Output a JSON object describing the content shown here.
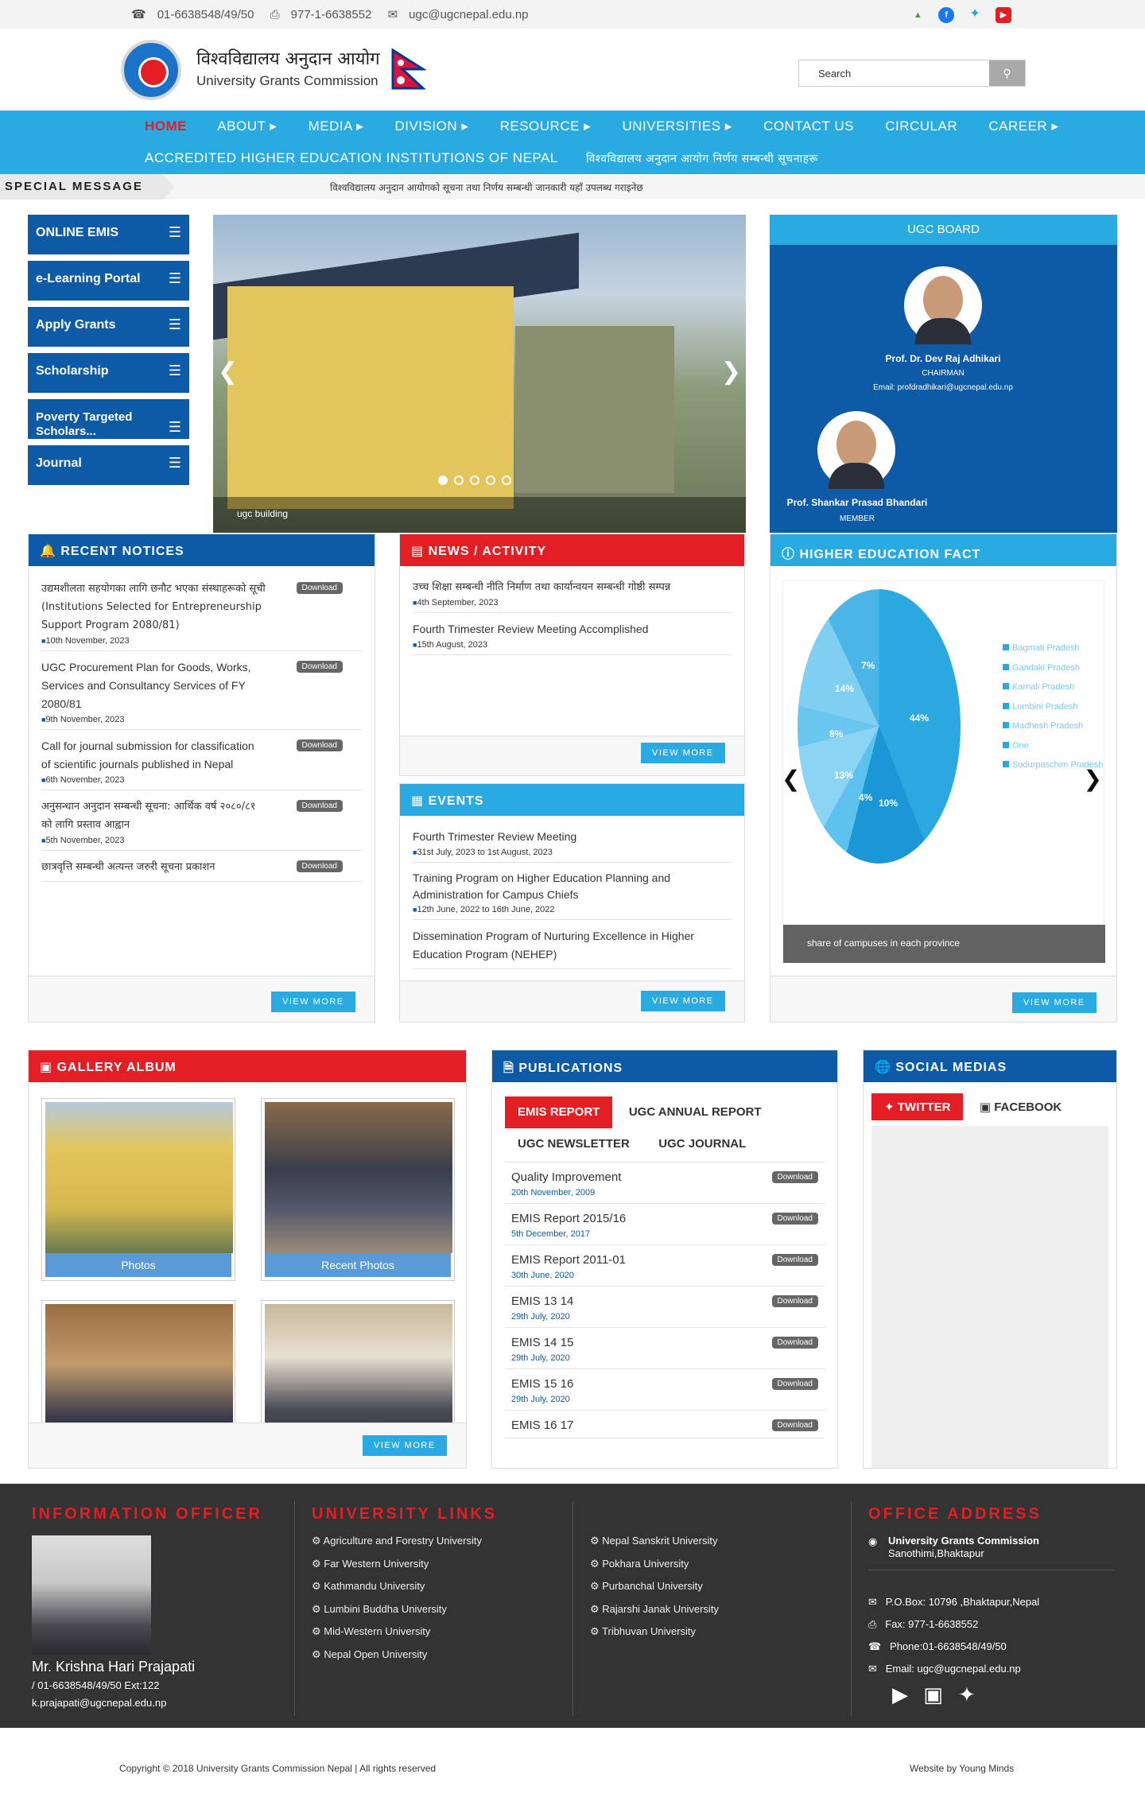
{
  "topbar": {
    "phone": "01-6638548/49/50",
    "fax": "977-1-6638552",
    "email": "ugc@ugcnepal.edu.np"
  },
  "brand": {
    "title_np": "विश्वविद्यालय अनुदान आयोग",
    "title_en": "University Grants Commission"
  },
  "search": {
    "placeholder": "Search"
  },
  "nav": {
    "items": [
      "HOME",
      "ABOUT",
      "MEDIA",
      "DIVISION",
      "RESOURCE",
      "UNIVERSITIES",
      "CONTACT US",
      "CIRCULAR",
      "CAREER"
    ],
    "row2a": "ACCREDITED HIGHER EDUCATION INSTITUTIONS OF NEPAL",
    "row2b": "विश्वविद्यालय अनुदान आयोग निर्णय सम्बन्धी सूचनाहरू"
  },
  "special": {
    "label": "SPECIAL MESSAGE",
    "message": "विश्वविद्यालय अनुदान आयोगको सूचना तथा निर्णय सम्बन्धी जानकारी यहाँ उपलब्ध गराइनेछ"
  },
  "sidebar": [
    "ONLINE EMIS",
    "e-Learning Portal",
    "Apply Grants",
    "Scholarship",
    "Poverty Targeted Scholars...",
    "Journal"
  ],
  "slider": {
    "caption": "ugc building"
  },
  "board": {
    "title": "UGC BOARD",
    "m1_name": "Prof. Dr. Dev Raj Adhikari",
    "m1_role": "CHAIRMAN",
    "m1_email": "Email: profdradhikari@ugcnepal.edu.np",
    "m2_name": "Prof. Shankar Prasad Bhandari",
    "m2_role": "MEMBER"
  },
  "notices": {
    "title": "RECENT NOTICES",
    "download": "Download",
    "view_more": "VIEW MORE",
    "items": [
      {
        "t": "उद्यमशीलता सहयोगका लागि छनौट भएका संस्थाहरूको सूची (Institutions Selected for Entrepreneurship Support Program 2080/81)",
        "d": "10th November, 2023"
      },
      {
        "t": "UGC Procurement Plan for Goods, Works, Services and Consultancy Services of FY 2080/81",
        "d": "9th November, 2023"
      },
      {
        "t": "Call for journal submission for classification of scientific journals published in Nepal",
        "d": "6th November, 2023"
      },
      {
        "t": "अनुसन्धान अनुदान सम्बन्धी सूचना: आर्थिक वर्ष २०८०/८१ को लागि प्रस्ताव आह्वान",
        "d": "5th November, 2023"
      },
      {
        "t": "छात्रवृत्ति सम्बन्धी अत्यन्त जरुरी सूचना प्रकाशन",
        "d": ""
      }
    ]
  },
  "news": {
    "title": "NEWS / ACTIVITY",
    "view_more": "VIEW MORE",
    "items": [
      {
        "t": "उच्च शिक्षा सम्बन्धी नीति निर्माण तथा कार्यान्वयन सम्बन्धी गोष्ठी सम्पन्न",
        "d": "4th September, 2023"
      },
      {
        "t": "Fourth Trimester Review Meeting Accomplished",
        "d": "15th August, 2023"
      }
    ]
  },
  "events": {
    "title": "EVENTS",
    "view_more": "VIEW MORE",
    "items": [
      {
        "t": "Fourth Trimester Review Meeting",
        "d": "31st July, 2023 to 1st August, 2023"
      },
      {
        "t": "Training Program on Higher Education Planning and Administration for Campus Chiefs",
        "d": "12th June, 2022 to 16th June, 2022"
      },
      {
        "t": "Dissemination Program of Nurturing Excellence in Higher Education Program (NEHEP)",
        "d": ""
      }
    ]
  },
  "fact": {
    "title": "HIGHER EDUCATION FACT",
    "caption": "share of campuses in each province",
    "view_more": "VIEW MORE",
    "legend": [
      "Bagmati Pradesh",
      "Gandaki Pradesh",
      "Karnali Pradesh",
      "Lumbini Pradesh",
      "Madhesh Pradesh",
      "One",
      "Sudurpaschim Pradesh"
    ],
    "pcts": [
      "44%",
      "10%",
      "4%",
      "13%",
      "8%",
      "14%",
      "7%"
    ]
  },
  "gallery": {
    "title": "GALLERY ALBUM",
    "view_more": "VIEW MORE",
    "albums": [
      "Photos",
      "Recent Photos"
    ]
  },
  "publications": {
    "title": "PUBLICATIONS",
    "download": "Download",
    "tabs": [
      "EMIS REPORT",
      "UGC ANNUAL REPORT",
      "UGC NEWSLETTER",
      "UGC JOURNAL"
    ],
    "items": [
      {
        "t": "Quality Improvement",
        "d": "20th November, 2009"
      },
      {
        "t": "EMIS Report 2015/16",
        "d": "5th December, 2017"
      },
      {
        "t": "EMIS Report 2011-01",
        "d": "30th June, 2020"
      },
      {
        "t": "EMIS 13 14",
        "d": "29th July, 2020"
      },
      {
        "t": "EMIS 14 15",
        "d": "29th July, 2020"
      },
      {
        "t": "EMIS 15 16",
        "d": "29th July, 2020"
      },
      {
        "t": "EMIS 16 17",
        "d": ""
      }
    ]
  },
  "social": {
    "title": "SOCIAL MEDIAS",
    "tabs": [
      "TWITTER",
      "FACEBOOK"
    ]
  },
  "footer": {
    "info_title": "INFORMATION OFFICER",
    "officer_name": "Mr. Krishna Hari Prajapati",
    "officer_phone": "/ 01-6638548/49/50 Ext:122",
    "officer_email": "k.prajapati@ugcnepal.edu.np",
    "links_title": "UNIVERSITY LINKS",
    "links1": [
      "Agriculture and Forestry University",
      "Far Western University",
      "Kathmandu University",
      "Lumbini Buddha University",
      "Mid-Western University",
      "Nepal Open University"
    ],
    "links2": [
      "Nepal Sanskrit University",
      "Pokhara University",
      "Purbanchal University",
      "Rajarshi Janak University",
      "Tribhuvan University"
    ],
    "office_title": "OFFICE ADDRESS",
    "office_name": "University Grants Commission",
    "office_loc": "Sanothimi,Bhaktapur",
    "pobox": "P.O.Box: 10796 ,Bhaktapur,Nepal",
    "fax": "Fax: 977-1-6638552",
    "phone": "Phone:01-6638548/49/50",
    "email": "Email: ugc@ugcnepal.edu.np"
  },
  "copyright": {
    "text": "Copyright © 2018 University Grants Commission Nepal | All rights reserved",
    "credit_pre": "Website by",
    "credit": "Young Minds"
  },
  "colors": {
    "primary": "#0d5aa6",
    "accent": "#29abe2",
    "red": "#e31e24",
    "footer": "#333333"
  }
}
